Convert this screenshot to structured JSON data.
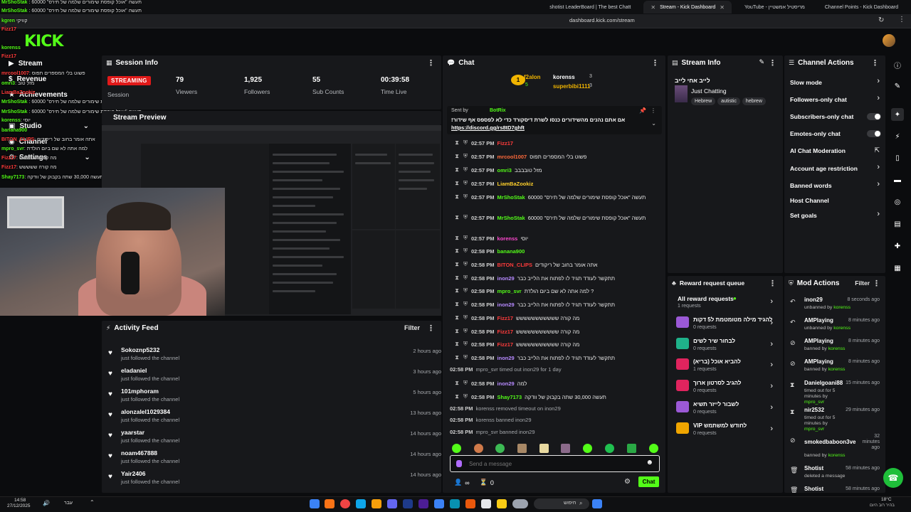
{
  "browser": {
    "tabs": [
      {
        "label": "shotist LeaderBoard | The best Chatt",
        "active": false
      },
      {
        "label": "Stream - Kick Dashboard",
        "active": true
      },
      {
        "label": "YouTube - מריסטיל אמשטיין",
        "active": false
      },
      {
        "label": "Channel Points - Kick Dashboard",
        "active": false
      }
    ],
    "url": "dashboard.kick.com/stream"
  },
  "app": {
    "logo": "KICK",
    "accent": "#53fc18"
  },
  "leftnav": {
    "items": [
      {
        "label": "Stream"
      },
      {
        "label": "Revenue"
      },
      {
        "label": "Achievements"
      },
      {
        "label": "Studio"
      },
      {
        "label": "Channel"
      },
      {
        "label": "Settings"
      }
    ]
  },
  "overlay_chat": [
    {
      "user": "MrShoStak",
      "text": ": 60000 \"תעשה \"אוכל קופסת שימורים שלמה של תירס"
    },
    {
      "user": "MrShoStak",
      "text": ": 60000 \"תעשה \"אוכל קופסת שימורים שלמה של תירס"
    },
    {
      "user": "kgren",
      "text": "קוויקי"
    },
    {
      "user": "Fizz17",
      "text": ""
    },
    {
      "user": "korenss",
      "text": ""
    },
    {
      "user": "Fizz17",
      "text": ""
    },
    {
      "user": "mrcool1007",
      "text": ": פשוט בלי המספרים תפוס"
    },
    {
      "user": "omri3",
      "text": ": מזל טוב"
    },
    {
      "user": "LiamBaZookiz",
      "text": ""
    },
    {
      "user": "MrShoStak",
      "text": ": 60000 \"תעשה \"אוכל קופסת שימורים שלמה של תירס"
    },
    {
      "user": "MrShoStak",
      "text": ": 60000 \"תעשה \"אוכל קופסת שימורים שלמה של תירס"
    },
    {
      "user": "korenss",
      "text": ": יוסי"
    },
    {
      "user": "banana900",
      "text": ""
    },
    {
      "user": "BITON_CLIPS",
      "text": ": אתה אומר בחוב של ריקודים"
    },
    {
      "user": "mpro_svr",
      "text": ": למה אתה לא שם ביום הולדת"
    },
    {
      "user": "Fizz17",
      "text": ": מה קורה ששששש"
    },
    {
      "user": "Fizz17",
      "text": ": מה קורה ששששש"
    },
    {
      "user": "Shay7173",
      "text": ": תעשה 30,000 שתה בקבוק של וודקה"
    }
  ],
  "session": {
    "title": "Session Info",
    "status": "STREAMING",
    "status_label": "Session",
    "stats": [
      {
        "value": "79",
        "label": "Viewers"
      },
      {
        "value": "1,925",
        "label": "Followers"
      },
      {
        "value": "55",
        "label": "Sub Counts"
      },
      {
        "value": "00:39:58",
        "label": "Time Live"
      }
    ]
  },
  "preview": {
    "title": "Stream Preview"
  },
  "activity": {
    "title": "Activity Feed",
    "filter": "Filter",
    "items": [
      {
        "user": "Sokoznp5232",
        "action": "just followed the channel",
        "time": "2 hours ago"
      },
      {
        "user": "eladaniel",
        "action": "just followed the channel",
        "time": "3 hours ago"
      },
      {
        "user": "101mphoram",
        "action": "just followed the channel",
        "time": "5 hours ago"
      },
      {
        "user": "alonzalel1029384",
        "action": "just followed the channel",
        "time": "13 hours ago"
      },
      {
        "user": "yaarstar",
        "action": "just followed the channel",
        "time": "14 hours ago"
      },
      {
        "user": "noam467888",
        "action": "just followed the channel",
        "time": "14 hours ago"
      },
      {
        "user": "Yair2406",
        "action": "just followed the channel",
        "time": "14 hours ago"
      }
    ]
  },
  "chat": {
    "title": "Chat",
    "leaderboard": [
      {
        "rank": "1",
        "user": "f2alon",
        "count": "5"
      },
      {
        "rank": "",
        "user": "korenss",
        "count": "3"
      },
      {
        "rank": "",
        "user": "superbibi1111",
        "count": "3"
      }
    ],
    "pinned": {
      "sent_by_label": "Sent by",
      "sender": "BotRix",
      "text": "!אם אתם נהנים מהשידורים כנסו לשרת דיסקורד כדי לא לפספס אף שידור",
      "link": "https://discord.gg/rs8tD7ghft"
    },
    "messages": [
      {
        "time": "02:57 PM",
        "user": "Fizz17",
        "text": "",
        "color": "#ff3b3b"
      },
      {
        "time": "02:57 PM",
        "user": "mrcool1007",
        "text": "פשוט בלי המספרים תפוס",
        "color": "#ff3b3b"
      },
      {
        "time": "02:57 PM",
        "user": "omri3",
        "text": "מזל טובבבב",
        "color": "#53fc18"
      },
      {
        "time": "02:57 PM",
        "user": "LiamBaZookiz",
        "text": "",
        "color": "#ffd02b"
      },
      {
        "time": "02:57 PM",
        "user": "MrShoStak",
        "text": "תעשה \"אוכל קופסת שימורים שלמה של תירס\" 60000",
        "color": "#53fc18"
      },
      {
        "time": "02:57 PM",
        "user": "MrShoStak",
        "text": "תעשה \"אוכל קופסת שימורים שלמה של תירס\" 60000",
        "color": "#53fc18"
      },
      {
        "time": "02:57 PM",
        "user": "korenss",
        "text": "יוסי",
        "color": "#ff48d0"
      },
      {
        "time": "02:58 PM",
        "user": "banana900",
        "text": "",
        "color": "#53fc18"
      },
      {
        "time": "02:58 PM",
        "user": "BITON_CLIPS",
        "text": "אתה אומר בחוב של ריקודים",
        "color": "#ff3b3b"
      },
      {
        "time": "02:58 PM",
        "user": "inon29",
        "text": "תתקשר לעודד תגיד לו לפתוח את הלייב כבר",
        "color": "#b78aff"
      },
      {
        "time": "02:58 PM",
        "user": "mpro_svr",
        "text": "למה אתה לא שם ביום הולדת ?",
        "color": "#53fc18"
      },
      {
        "time": "02:58 PM",
        "user": "inon29",
        "text": "תתקשר לעודד תגיד לו לפתוח את הלייב כבר",
        "color": "#b78aff"
      },
      {
        "time": "02:58 PM",
        "user": "Fizz17",
        "text": "מה קורה ששששששששששש",
        "color": "#ff3b3b"
      },
      {
        "time": "02:58 PM",
        "user": "Fizz17",
        "text": "מה קורה ששששששששששש",
        "color": "#ff3b3b"
      },
      {
        "time": "02:58 PM",
        "user": "Fizz17",
        "text": "מה קורה ששששששששששש",
        "color": "#ff3b3b"
      },
      {
        "time": "02:58 PM",
        "user": "inon29",
        "text": "תתקשר לעודד תגיד לו לפתוח את הלייב כבר",
        "color": "#b78aff"
      }
    ],
    "system1": {
      "time": "02:58 PM",
      "text": "mpro_svr timed out inon29 for 1 day"
    },
    "messages2": [
      {
        "time": "02:58 PM",
        "user": "inon29",
        "text": "למה",
        "color": "#b78aff"
      },
      {
        "time": "02:58 PM",
        "user": "Shay7173",
        "text": "תעשה 30,000 שתה בקבוק של וודקה",
        "color": "#53fc18"
      }
    ],
    "system2": [
      {
        "time": "02:58 PM",
        "text": "korenss removed timeout on inon29"
      },
      {
        "time": "02:58 PM",
        "text": "korenss banned inon29"
      },
      {
        "time": "02:58 PM",
        "text": "mpro_svr banned inon29"
      }
    ],
    "input_placeholder": "Send a message",
    "infinity": "∞",
    "counter": "0",
    "send_label": "Chat"
  },
  "stream_info": {
    "title": "Stream Info",
    "stream_title": "לייב אחי לייב",
    "category": "Just Chatting",
    "tags": [
      "Hebrew",
      "autistic",
      "hebrew"
    ]
  },
  "channel_actions": {
    "title": "Channel Actions",
    "items": [
      {
        "label": "Slow mode",
        "control": "arrow"
      },
      {
        "label": "Followers-only chat",
        "control": "arrow"
      },
      {
        "label": "Subscribers-only chat",
        "control": "toggle"
      },
      {
        "label": "Emotes-only chat",
        "control": "toggle"
      },
      {
        "label": "AI Chat Moderation",
        "control": "external"
      },
      {
        "label": "Account age restriction",
        "control": "arrow"
      },
      {
        "label": "Banned words",
        "control": "arrow"
      },
      {
        "label": "Host Channel",
        "control": "none"
      },
      {
        "label": "Set goals",
        "control": "arrow"
      }
    ]
  },
  "reward_queue": {
    "title": "Reward request queue",
    "all_label": "All reward requests",
    "all_sub": "1 requests",
    "items": [
      {
        "title": "להגיד מילה מטומטמת ל5 דקות",
        "sub": "0 requests",
        "color": "#9b59d6"
      },
      {
        "title": "לבחור שיר לשים",
        "sub": "0 requests",
        "color": "#1fb28a"
      },
      {
        "title": "להביא אוכל (בריא)",
        "sub": "1 requests",
        "color": "#e0245e"
      },
      {
        "title": "להגיב לסרטון ארוך",
        "sub": "0 requests",
        "color": "#e0245e"
      },
      {
        "title": "לשבור לייזר תשיא",
        "sub": "0 requests",
        "color": "#9b59d6"
      },
      {
        "title": "VIP לחודש למשתמש",
        "sub": "0 requests",
        "color": "#f0a500"
      }
    ]
  },
  "mod_actions": {
    "title": "Mod Actions",
    "filter": "Filter",
    "items": [
      {
        "user": "inon29",
        "desc": "unbanned by",
        "by": "korenss",
        "time": "8 seconds ago",
        "icon": "undo-icon"
      },
      {
        "user": "AMPlaying",
        "desc": "unbanned by",
        "by": "korenss",
        "time": "8 minutes ago",
        "icon": "undo-icon"
      },
      {
        "user": "AMPlaying",
        "desc": "banned by",
        "by": "korenss",
        "time": "8 minutes ago",
        "icon": "ban-icon"
      },
      {
        "user": "AMPlaying",
        "desc": "banned by",
        "by": "korenss",
        "time": "8 minutes ago",
        "icon": "ban-icon"
      },
      {
        "user": "Danielgoani88",
        "desc": "timed out for 5 minutes by",
        "by": "mpro_svr",
        "time": "15 minutes ago",
        "icon": "hourglass-icon"
      },
      {
        "user": "nir2532",
        "desc": "timed out for 5 minutes by",
        "by": "mpro_svr",
        "time": "29 minutes ago",
        "icon": "hourglass-icon"
      },
      {
        "user": "smokedbaboon3ve",
        "desc": "banned by",
        "by": "korenss",
        "time": "32 minutes ago",
        "icon": "ban-icon"
      },
      {
        "user": "Shotist",
        "desc": "deleted a message",
        "by": "",
        "time": "58 minutes ago",
        "icon": "trash-icon"
      },
      {
        "user": "Shotist",
        "desc": "",
        "by": "",
        "time": "58 minutes ago",
        "icon": "trash-icon"
      }
    ]
  },
  "taskbar": {
    "time": "14:58",
    "date": "27/12/2025",
    "lang": "עבר",
    "search": "חיפוש",
    "weather": "18°C",
    "weather_sub": "בהיר רוב היום"
  }
}
